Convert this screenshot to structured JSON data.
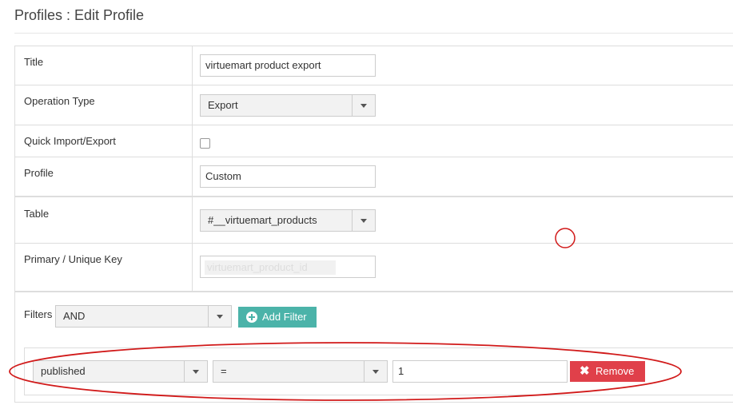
{
  "page": {
    "title": "Profiles : Edit Profile"
  },
  "form": {
    "title_label": "Title",
    "title_value": "virtuemart product export",
    "operation_label": "Operation Type",
    "operation_value": "Export",
    "quick_label": "Quick Import/Export",
    "quick_checked": false,
    "profile_label": "Profile",
    "profile_value": "Custom",
    "table_label": "Table",
    "table_value": "#__virtuemart_products",
    "primary_label": "Primary / Unique Key",
    "primary_value": "virtuemart_product_id",
    "filters_label": "Filters",
    "filters_logic": "AND",
    "add_filter_label": "Add Filter"
  },
  "filter_rows": [
    {
      "field": "published",
      "operator": "=",
      "value": "1",
      "remove_label": "Remove"
    }
  ],
  "colors": {
    "add_button": "#4bb3a9",
    "remove_button": "#e0404a",
    "annotation": "#d11a1a"
  },
  "icons": {
    "add": "plus-circle-icon",
    "remove": "x-icon",
    "select": "chevron-down-icon"
  }
}
